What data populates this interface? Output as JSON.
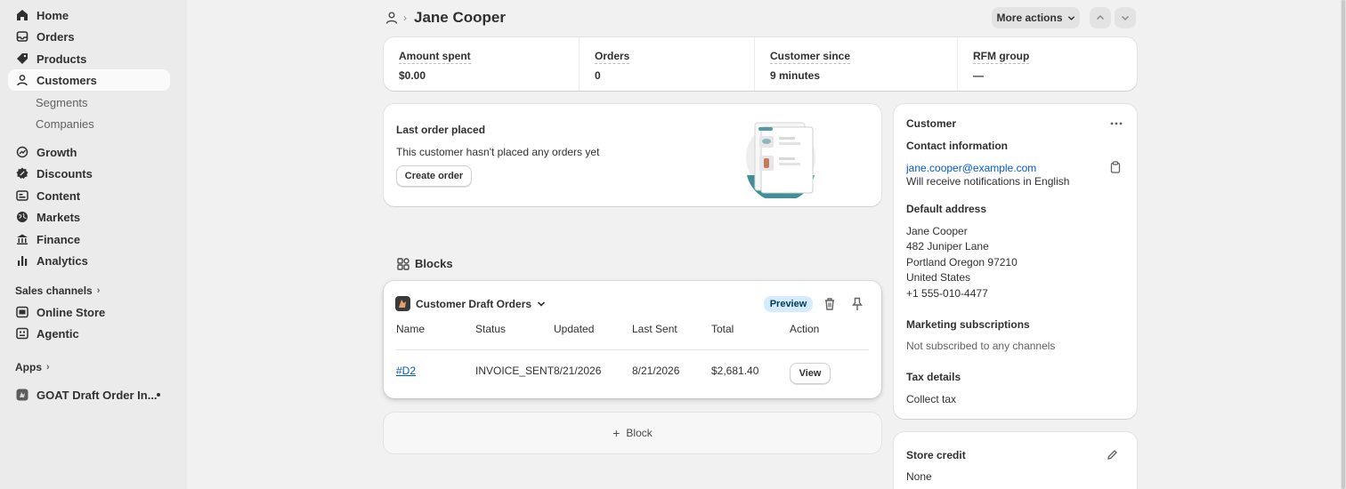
{
  "sidebar": {
    "items": [
      {
        "label": "Home",
        "icon": "home-icon"
      },
      {
        "label": "Orders",
        "icon": "inbox-icon"
      },
      {
        "label": "Products",
        "icon": "tag-icon"
      },
      {
        "label": "Customers",
        "icon": "person-icon"
      },
      {
        "label": "Growth",
        "icon": "growth-icon"
      },
      {
        "label": "Discounts",
        "icon": "discount-icon"
      },
      {
        "label": "Content",
        "icon": "content-icon"
      },
      {
        "label": "Markets",
        "icon": "globe-icon"
      },
      {
        "label": "Finance",
        "icon": "bank-icon"
      },
      {
        "label": "Analytics",
        "icon": "bar-chart-icon"
      },
      {
        "label": "Online Store",
        "icon": "store-icon"
      },
      {
        "label": "Agentic",
        "icon": "agentic-icon"
      },
      {
        "label": "GOAT Draft Order In...",
        "icon": "app-icon"
      }
    ],
    "sub_items": [
      "Segments",
      "Companies"
    ],
    "sections": {
      "sales_channels": "Sales channels",
      "apps": "Apps"
    }
  },
  "header": {
    "title": "Jane Cooper",
    "more_actions": "More actions"
  },
  "stats": [
    {
      "label": "Amount spent",
      "value": "$0.00"
    },
    {
      "label": "Orders",
      "value": "0"
    },
    {
      "label": "Customer since",
      "value": "9 minutes"
    },
    {
      "label": "RFM group",
      "value": "—"
    }
  ],
  "last_order": {
    "title": "Last order placed",
    "message": "This customer hasn't placed any orders yet",
    "button": "Create order"
  },
  "blocks": {
    "title": "Blocks",
    "card_title": "Customer Draft Orders",
    "badge": "Preview",
    "columns": [
      "Name",
      "Status",
      "Updated",
      "Last Sent",
      "Total",
      "Action"
    ],
    "rows": [
      {
        "name": "#D2",
        "status": "INVOICE_SENT",
        "updated": "8/21/2026",
        "last_sent": "8/21/2026",
        "total": "$2,681.40",
        "action": "View"
      }
    ],
    "add_block": "Block"
  },
  "customer": {
    "title": "Customer",
    "contact_heading": "Contact information",
    "email": "jane.cooper@example.com",
    "notifications": "Will receive notifications in English",
    "address_heading": "Default address",
    "address_lines": [
      "Jane Cooper",
      "482 Juniper Lane",
      "Portland Oregon 97210",
      "United States",
      "+1 555-010-4477"
    ],
    "marketing_heading": "Marketing subscriptions",
    "marketing_value": "Not subscribed to any channels",
    "tax_heading": "Tax details",
    "tax_value": "Collect tax"
  },
  "store_credit": {
    "title": "Store credit",
    "value": "None"
  },
  "colors": {
    "link": "#005bd3",
    "badge_bg": "#d5ebff",
    "illustration_teal": "#3f8f98"
  }
}
